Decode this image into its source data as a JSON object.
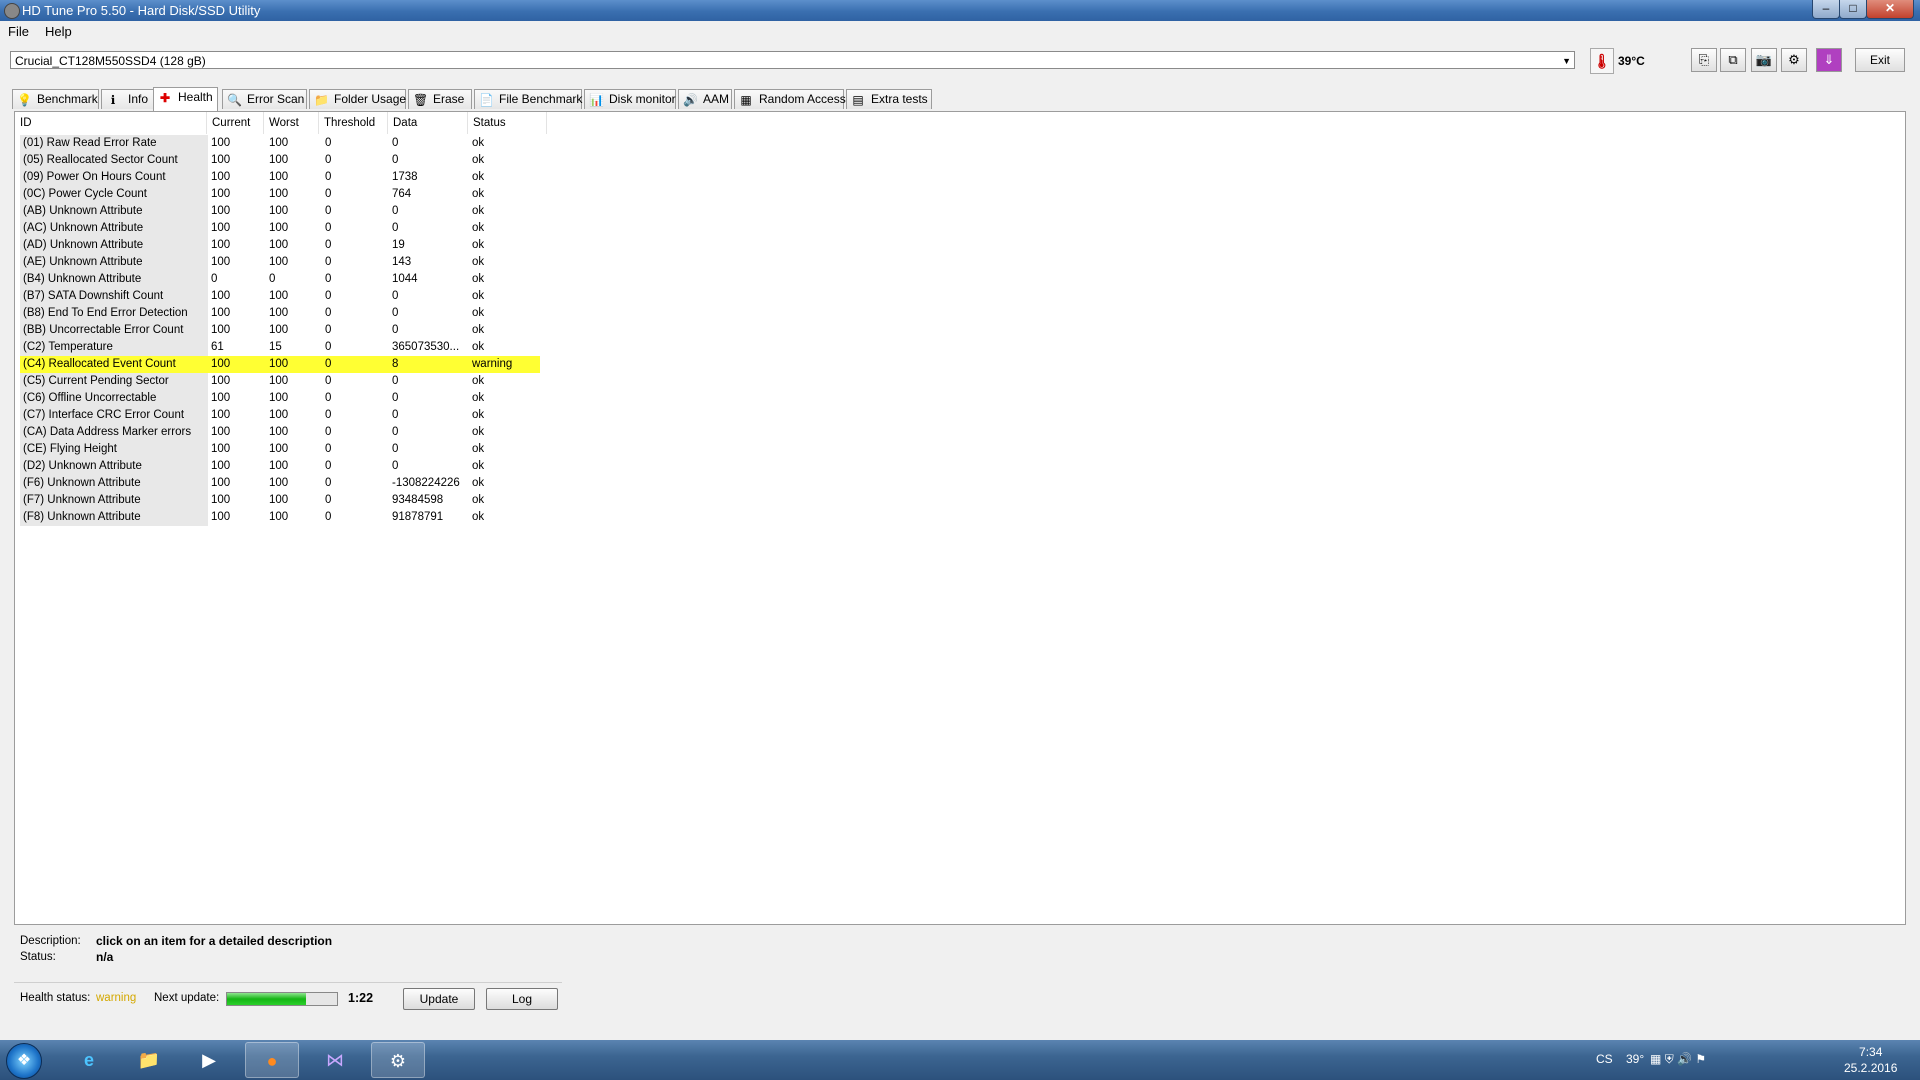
{
  "window": {
    "title": "HD Tune Pro 5.50 - Hard Disk/SSD Utility",
    "min": "–",
    "max": "□",
    "close": "✕"
  },
  "menu": [
    "File",
    "Help"
  ],
  "drive": {
    "selected": "Crucial_CT128M550SSD4 (128 gB)"
  },
  "temperature": "39°C",
  "toolbar": {
    "exit_label": "Exit"
  },
  "tabs": [
    {
      "label": "Benchmark",
      "icon": "💡"
    },
    {
      "label": "Info",
      "icon": "ℹ"
    },
    {
      "label": "Health",
      "icon": "✚"
    },
    {
      "label": "Error Scan",
      "icon": "🔍"
    },
    {
      "label": "Folder Usage",
      "icon": "📁"
    },
    {
      "label": "Erase",
      "icon": "🗑"
    },
    {
      "label": "File Benchmark",
      "icon": "📄"
    },
    {
      "label": "Disk monitor",
      "icon": "📊"
    },
    {
      "label": "AAM",
      "icon": "🔊"
    },
    {
      "label": "Random Access",
      "icon": "▦"
    },
    {
      "label": "Extra tests",
      "icon": "▤"
    }
  ],
  "table": {
    "headers": [
      "ID",
      "Current",
      "Worst",
      "Threshold",
      "Data",
      "Status"
    ],
    "rows": [
      {
        "id": "(01) Raw Read Error Rate",
        "current": "100",
        "worst": "100",
        "threshold": "0",
        "data": "0",
        "status": "ok"
      },
      {
        "id": "(05) Reallocated Sector Count",
        "current": "100",
        "worst": "100",
        "threshold": "0",
        "data": "0",
        "status": "ok"
      },
      {
        "id": "(09) Power On Hours Count",
        "current": "100",
        "worst": "100",
        "threshold": "0",
        "data": "1738",
        "status": "ok"
      },
      {
        "id": "(0C) Power Cycle Count",
        "current": "100",
        "worst": "100",
        "threshold": "0",
        "data": "764",
        "status": "ok"
      },
      {
        "id": "(AB) Unknown Attribute",
        "current": "100",
        "worst": "100",
        "threshold": "0",
        "data": "0",
        "status": "ok"
      },
      {
        "id": "(AC) Unknown Attribute",
        "current": "100",
        "worst": "100",
        "threshold": "0",
        "data": "0",
        "status": "ok"
      },
      {
        "id": "(AD) Unknown Attribute",
        "current": "100",
        "worst": "100",
        "threshold": "0",
        "data": "19",
        "status": "ok"
      },
      {
        "id": "(AE) Unknown Attribute",
        "current": "100",
        "worst": "100",
        "threshold": "0",
        "data": "143",
        "status": "ok"
      },
      {
        "id": "(B4) Unknown Attribute",
        "current": "0",
        "worst": "0",
        "threshold": "0",
        "data": "1044",
        "status": "ok"
      },
      {
        "id": "(B7) SATA Downshift Count",
        "current": "100",
        "worst": "100",
        "threshold": "0",
        "data": "0",
        "status": "ok"
      },
      {
        "id": "(B8) End To End Error Detection",
        "current": "100",
        "worst": "100",
        "threshold": "0",
        "data": "0",
        "status": "ok"
      },
      {
        "id": "(BB) Uncorrectable Error Count",
        "current": "100",
        "worst": "100",
        "threshold": "0",
        "data": "0",
        "status": "ok"
      },
      {
        "id": "(C2) Temperature",
        "current": "61",
        "worst": "15",
        "threshold": "0",
        "data": "365073530...",
        "status": "ok"
      },
      {
        "id": "(C4) Reallocated Event Count",
        "current": "100",
        "worst": "100",
        "threshold": "0",
        "data": "8",
        "status": "warning",
        "highlight": true
      },
      {
        "id": "(C5) Current Pending Sector",
        "current": "100",
        "worst": "100",
        "threshold": "0",
        "data": "0",
        "status": "ok"
      },
      {
        "id": "(C6) Offline Uncorrectable",
        "current": "100",
        "worst": "100",
        "threshold": "0",
        "data": "0",
        "status": "ok"
      },
      {
        "id": "(C7) Interface CRC Error Count",
        "current": "100",
        "worst": "100",
        "threshold": "0",
        "data": "0",
        "status": "ok"
      },
      {
        "id": "(CA) Data Address Marker errors",
        "current": "100",
        "worst": "100",
        "threshold": "0",
        "data": "0",
        "status": "ok"
      },
      {
        "id": "(CE) Flying Height",
        "current": "100",
        "worst": "100",
        "threshold": "0",
        "data": "0",
        "status": "ok"
      },
      {
        "id": "(D2) Unknown Attribute",
        "current": "100",
        "worst": "100",
        "threshold": "0",
        "data": "0",
        "status": "ok"
      },
      {
        "id": "(F6) Unknown Attribute",
        "current": "100",
        "worst": "100",
        "threshold": "0",
        "data": "-1308224226",
        "status": "ok"
      },
      {
        "id": "(F7) Unknown Attribute",
        "current": "100",
        "worst": "100",
        "threshold": "0",
        "data": "93484598",
        "status": "ok"
      },
      {
        "id": "(F8) Unknown Attribute",
        "current": "100",
        "worst": "100",
        "threshold": "0",
        "data": "91878791",
        "status": "ok"
      }
    ]
  },
  "details": {
    "description_label": "Description:",
    "description_value": "click on an item for a detailed description",
    "status_label": "Status:",
    "status_value": "n/a"
  },
  "health": {
    "label": "Health status:",
    "value": "warning",
    "value_color": "#d4a800",
    "next_update_label": "Next update:",
    "progress": 0.72,
    "time": "1:22",
    "update_button": "Update",
    "log_button": "Log"
  },
  "taskbar": {
    "tray_lang": "CS",
    "tray_temp": "39°",
    "time": "7:34",
    "date": "25.2.2016"
  }
}
